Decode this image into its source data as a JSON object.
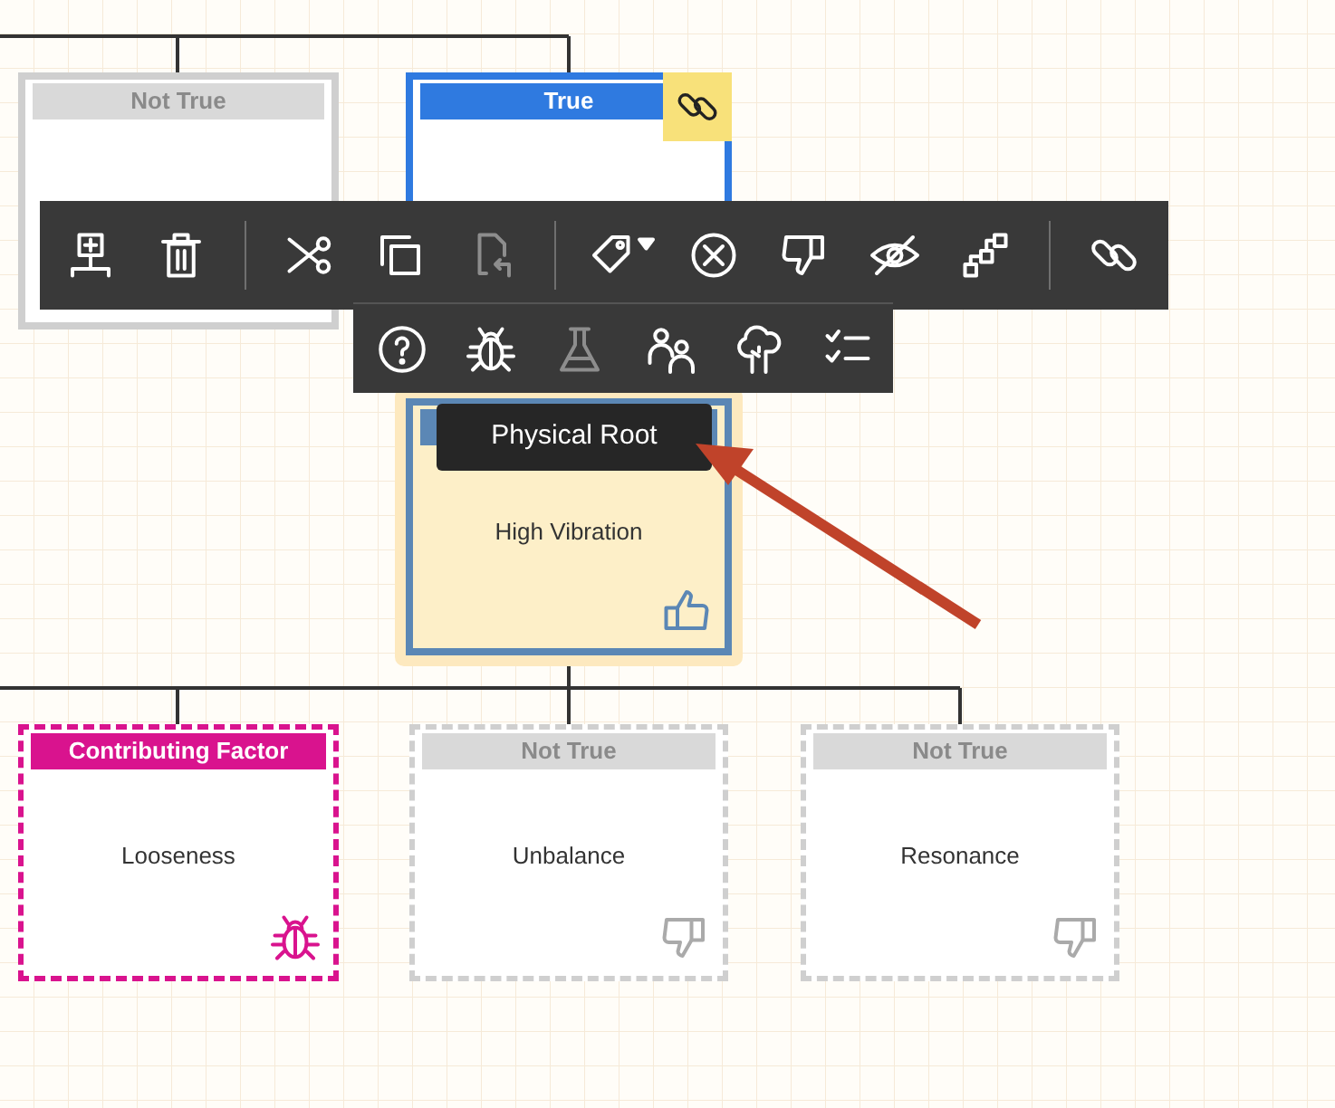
{
  "diagram": {
    "nodes": [
      {
        "kind": "not_true",
        "status": "Not True",
        "dashed": false,
        "selected": false,
        "linked": false
      },
      {
        "kind": "true",
        "status": "True",
        "dashed": false,
        "selected": false,
        "linked": true
      },
      {
        "kind": "true",
        "label": "High Vibration",
        "dashed": false,
        "selected": true,
        "linked": false,
        "icon": {
          "kind": "thumbs_up"
        }
      },
      {
        "kind": "contributing",
        "status": "Contributing Factor",
        "label": "Looseness",
        "dashed": true,
        "selected": false,
        "linked": false,
        "icon": {
          "kind": "bug"
        }
      },
      {
        "kind": "not_true",
        "status": "Not True",
        "label": "Unbalance",
        "dashed": true,
        "selected": false,
        "linked": false,
        "icon": {
          "kind": "thumbs_down"
        }
      },
      {
        "kind": "not_true",
        "status": "Not True",
        "label": "Resonance",
        "dashed": true,
        "selected": false,
        "linked": false,
        "icon": {
          "kind": "thumbs_down"
        }
      }
    ]
  },
  "toolbar": {
    "items": [
      {
        "kind": "add_node",
        "disabled": false
      },
      {
        "kind": "delete",
        "disabled": false
      },
      {
        "kind": "separator"
      },
      {
        "kind": "cut",
        "disabled": false
      },
      {
        "kind": "copy",
        "disabled": false
      },
      {
        "kind": "paste",
        "disabled": true
      },
      {
        "kind": "separator"
      },
      {
        "kind": "tag",
        "disabled": false
      },
      {
        "kind": "cancel",
        "disabled": false
      },
      {
        "kind": "thumbs_down",
        "disabled": false
      },
      {
        "kind": "hide",
        "disabled": false
      },
      {
        "kind": "hierarchy",
        "disabled": false
      },
      {
        "kind": "separator"
      },
      {
        "kind": "link",
        "disabled": false
      }
    ]
  },
  "type_toolbar": {
    "items": [
      {
        "kind": "help",
        "hovered": false
      },
      {
        "kind": "bug",
        "hovered": false
      },
      {
        "kind": "flask",
        "hovered": true
      },
      {
        "kind": "people",
        "hovered": false
      },
      {
        "kind": "tree",
        "hovered": false
      },
      {
        "kind": "checklist",
        "hovered": false
      }
    ]
  },
  "tooltip": {
    "text": "Physical Root"
  }
}
